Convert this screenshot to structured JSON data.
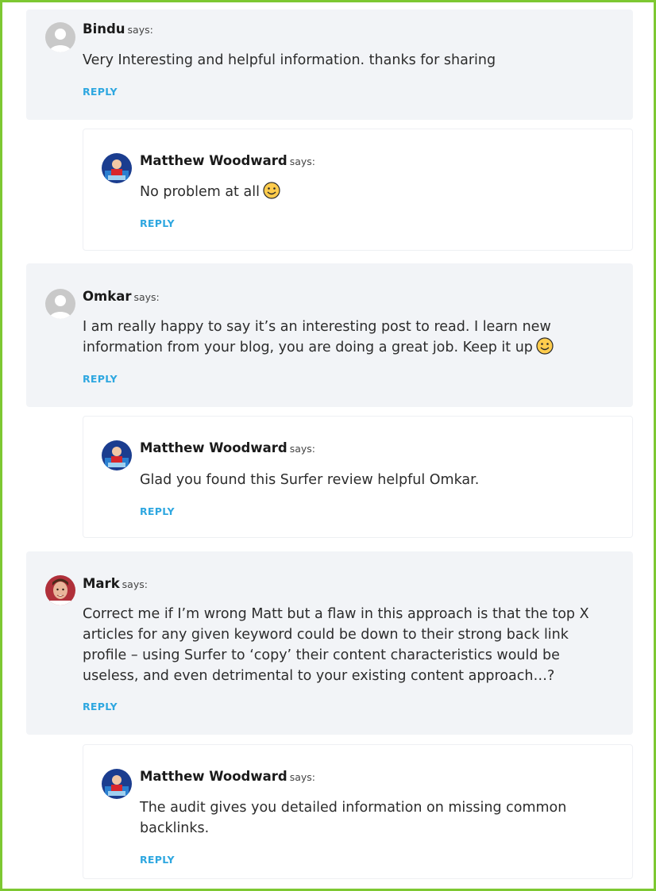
{
  "says_label": "says:",
  "comments": [
    {
      "author": "Bindu",
      "text": "Very Interesting and helpful information. thanks for sharing",
      "reply_label": "REPLY",
      "avatar": "default-avatar-icon"
    },
    {
      "author": "Matthew Woodward",
      "text": "No problem at all",
      "reply_label": "REPLY",
      "avatar": "matthew-woodward-avatar",
      "emoji": "smile-emoji-icon"
    },
    {
      "author": "Omkar",
      "text": "I am really happy to say it’s an interesting post to read. I learn new information from your blog, you are doing a great job. Keep it up",
      "reply_label": "REPLY",
      "avatar": "default-avatar-icon",
      "emoji": "smile-emoji-icon"
    },
    {
      "author": "Matthew Woodward",
      "text": "Glad you found this Surfer review helpful Omkar.",
      "reply_label": "REPLY",
      "avatar": "matthew-woodward-avatar"
    },
    {
      "author": "Mark",
      "text": "Correct me if I’m wrong Matt but a flaw in this approach is that the top X articles for any given keyword could be down to their strong back link profile – using Surfer to ‘copy’ their content characteristics would be useless, and even detrimental to your existing content approach…?",
      "reply_label": "REPLY",
      "avatar": "mark-avatar"
    },
    {
      "author": "Matthew Woodward",
      "text": "The audit gives you detailed information on missing common backlinks.",
      "reply_label": "REPLY",
      "avatar": "matthew-woodward-avatar"
    }
  ],
  "colors": {
    "border": "#7dc832",
    "parent_bg": "#f2f4f7",
    "reply": "#2ea7e0"
  }
}
